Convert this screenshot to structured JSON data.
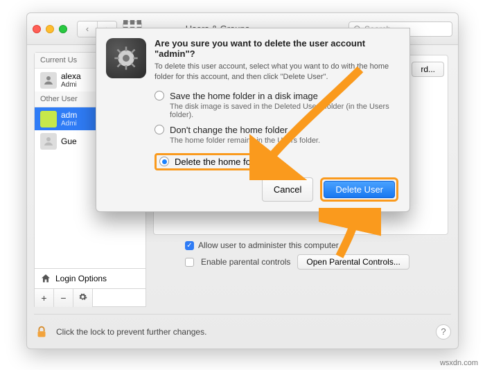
{
  "window": {
    "title": "Users & Groups",
    "search_placeholder": "Search"
  },
  "sidebar": {
    "current_header": "Current Us",
    "other_header": "Other User",
    "users": [
      {
        "name": "alexa",
        "role": "Admi"
      },
      {
        "name": "adm",
        "role": "Admi"
      },
      {
        "name": "Gue",
        "role": ""
      }
    ],
    "login_options": "Login Options",
    "plus": "+",
    "minus": "−"
  },
  "main": {
    "password_button": "rd...",
    "allow_admin": "Allow user to administer this computer",
    "enable_parental": "Enable parental controls",
    "open_parental": "Open Parental Controls..."
  },
  "footer": {
    "lock_text": "Click the lock to prevent further changes."
  },
  "sheet": {
    "title": "Are you sure you want to delete the user account \"admin\"?",
    "subtitle": "To delete this user account, select what you want to do with the home folder for this account, and then click \"Delete User\".",
    "opt1": {
      "label": "Save the home folder in a disk image",
      "desc": "The disk image is saved in the Deleted Users folder (in the Users folder)."
    },
    "opt2": {
      "label": "Don't change the home folder",
      "desc": "The home folder remains in the Users folder."
    },
    "opt3": {
      "label": "Delete the home folder"
    },
    "cancel": "Cancel",
    "delete": "Delete User"
  },
  "attribution": "wsxdn.com"
}
